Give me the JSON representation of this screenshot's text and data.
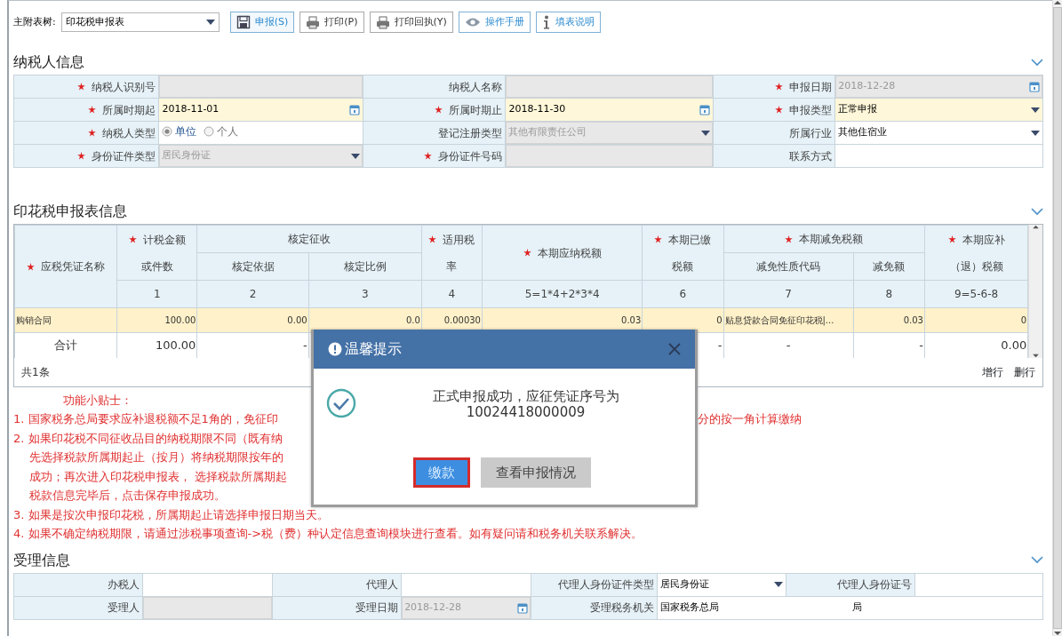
{
  "toolbar": {
    "label": "主附表树:",
    "select": "印花税申报表",
    "buttons": [
      {
        "label": "申报(S)",
        "kind": "accent",
        "selected": true
      },
      {
        "label": "打印(P)",
        "kind": "plain",
        "selected": false
      },
      {
        "label": "打印回执(Y)",
        "kind": "plain",
        "selected": false
      },
      {
        "label": "操作手册",
        "kind": "accent",
        "selected": false
      },
      {
        "label": "填表说明",
        "kind": "accent",
        "selected": false
      }
    ]
  },
  "taxpayer_info": {
    "title": "纳税人信息",
    "rows": [
      {
        "fields": [
          {
            "label": "纳税人识别号",
            "required": true,
            "kind": "text",
            "readonly": true,
            "highlighted": false
          },
          {
            "label": "纳税人名称",
            "required": false,
            "kind": "text",
            "readonly": true,
            "highlighted": false
          },
          {
            "label": "申报日期",
            "required": true,
            "kind": "date",
            "readonly": true,
            "highlighted": false,
            "value": "2018-12-28"
          }
        ]
      },
      {
        "fields": [
          {
            "label": "所属时期起",
            "required": true,
            "kind": "date",
            "readonly": false,
            "highlighted": true,
            "value": "2018-11-01"
          },
          {
            "label": "所属时期止",
            "required": true,
            "kind": "date",
            "readonly": false,
            "highlighted": true,
            "value": "2018-11-30"
          },
          {
            "label": "申报类型",
            "required": true,
            "kind": "select",
            "readonly": false,
            "highlighted": true,
            "value": "正常申报"
          }
        ]
      },
      {
        "fields": [
          {
            "label": "纳税人类型",
            "required": true,
            "kind": "radio",
            "readonly": false,
            "highlighted": false,
            "options": [
              {
                "label": "单位",
                "selected": true
              },
              {
                "label": "个人",
                "selected": false
              }
            ]
          },
          {
            "label": "登记注册类型",
            "required": false,
            "kind": "select",
            "readonly": true,
            "highlighted": false,
            "value": "其他有限责任公司"
          },
          {
            "label": "所属行业",
            "required": false,
            "kind": "select",
            "readonly": false,
            "highlighted": false,
            "value": "其他住宿业"
          }
        ]
      },
      {
        "fields": [
          {
            "label": "身份证件类型",
            "required": true,
            "kind": "select",
            "readonly": true,
            "highlighted": false,
            "value": "居民身份证"
          },
          {
            "label": "身份证件号码",
            "required": true,
            "kind": "text",
            "readonly": true,
            "highlighted": false
          },
          {
            "label": "联系方式",
            "required": false,
            "kind": "text",
            "readonly": false,
            "highlighted": false
          }
        ]
      }
    ]
  },
  "stamp_tax_table": {
    "title": "印花税申报表信息",
    "columns": [
      {
        "label_lines": [
          "应税凭证名称"
        ],
        "required": true
      },
      {
        "label_lines": [
          "计税金额",
          "或件数"
        ],
        "required": true,
        "number": "1"
      },
      {
        "label_lines": [
          "核定征收"
        ],
        "required": false,
        "colspan": 2,
        "children": [
          {
            "label": "核定依据",
            "number": "2"
          },
          {
            "label": "核定比例",
            "number": "3"
          }
        ]
      },
      {
        "label_lines": [
          "适用税",
          "率"
        ],
        "required": true,
        "number": "4"
      },
      {
        "label_lines": [
          "本期应纳税额"
        ],
        "required": true,
        "number": "5=1*4+2*3*4"
      },
      {
        "label_lines": [
          "本期已缴",
          "税额"
        ],
        "required": true,
        "number": "6"
      },
      {
        "label_lines": [
          "本期减免税额"
        ],
        "required": true,
        "colspan": 2,
        "children": [
          {
            "label": "减免性质代码",
            "number": "7"
          },
          {
            "label": "减免额",
            "number": "8"
          }
        ]
      },
      {
        "label_lines": [
          "本期应补",
          "（退）税额"
        ],
        "required": true,
        "number": "9=5-6-8"
      }
    ],
    "rows": [
      {
        "kind": "data",
        "highlighted": true,
        "cells": [
          "购销合同",
          "100.00",
          "0.00",
          "0.0",
          "0.00030",
          "0.03",
          "0",
          "贴息贷款合同免征印花税|...",
          "0.03",
          "0"
        ]
      },
      {
        "kind": "total",
        "highlighted": false,
        "cells": [
          "合计",
          "100.00",
          "-",
          null,
          null,
          null,
          "-",
          "-",
          "-",
          "0.00"
        ]
      }
    ],
    "count": "共1条",
    "actions": [
      "增行",
      "删行"
    ]
  },
  "tips": {
    "title": "功能小贴士：",
    "lines": [
      {
        "left": "1. 国家税务总局要求应补退税额不足1角的，免征印",
        "right": "分的按一角计算缴纳"
      },
      {
        "left": "2. 如果印花税不同征收品目的纳税期限不同（既有纳"
      },
      {
        "left": "先选择税款所属期起止（按月）将纳税期限按年的",
        "indent": true
      },
      {
        "left": "成功；再次进入印花税申报表， 选择税款所属期起",
        "indent": true
      },
      {
        "left": "税款信息完毕后，点击保存申报成功。",
        "indent": true
      },
      {
        "left": "3. 如果是按次申报印花税，所属期起止请选择申报日期当天。"
      },
      {
        "left": "4. 如果不确定纳税期限，请通过涉税事项查询->税（费）种认定信息查询模块进行查看。如有疑问请和税务机关联系解决。"
      }
    ]
  },
  "acceptance_info": {
    "title": "受理信息",
    "rows": [
      {
        "fields": [
          {
            "label": "办税人",
            "required": false,
            "kind": "text",
            "readonly": false,
            "highlighted": false
          },
          {
            "label": "代理人",
            "required": false,
            "kind": "text",
            "readonly": false,
            "highlighted": false
          },
          {
            "label": "代理人身份证件类型",
            "required": false,
            "kind": "select",
            "readonly": false,
            "highlighted": false,
            "value": "居民身份证"
          },
          {
            "label": "代理人身份证号",
            "required": false,
            "kind": "text",
            "readonly": false,
            "highlighted": false
          }
        ]
      },
      {
        "fields": [
          {
            "label": "受理人",
            "required": false,
            "kind": "text",
            "readonly": true,
            "highlighted": false
          },
          {
            "label": "受理日期",
            "required": false,
            "kind": "date",
            "readonly": true,
            "highlighted": false,
            "value": "2018-12-28"
          },
          {
            "label": "受理税务机关",
            "required": false,
            "kind": "text",
            "readonly": false,
            "highlighted": false,
            "value": "国家税务总局",
            "value_end": "局",
            "wide": true
          }
        ]
      }
    ]
  },
  "dialog": {
    "title": "温馨提示",
    "message_lines": [
      "正式申报成功，应征凭证序号为",
      "10024418000009"
    ],
    "buttons": [
      {
        "label": "缴款",
        "kind": "primary",
        "focused": true
      },
      {
        "label": "查看申报情况",
        "kind": "secondary",
        "focused": false
      }
    ]
  }
}
